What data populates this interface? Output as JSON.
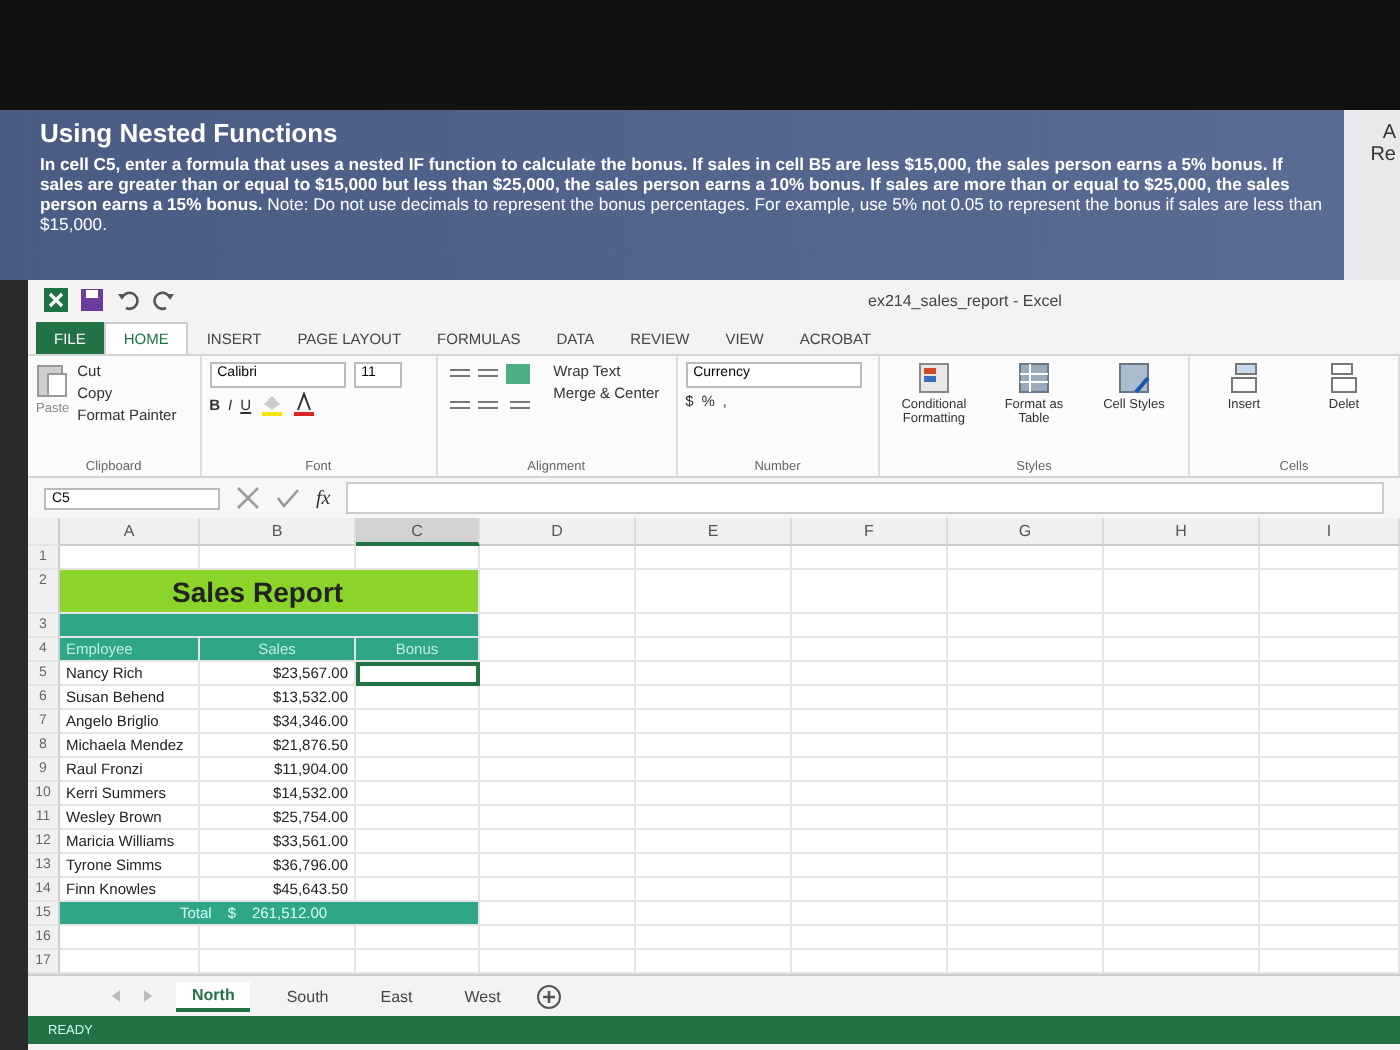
{
  "instructions": {
    "title": "Using Nested Functions",
    "text": "**In cell C5, enter a formula that uses a nested IF function to calculate the bonus. If sales in cell B5 are less $15,000, the sales person earns a 5% bonus. If sales are greater than or equal to $15,000 but less than $25,000, the sales person earns a 10% bonus. If sales are more than or equal to $25,000, the sales person earns a 15% bonus.** Note: Do not use decimals to represent the bonus percentages. For example, use 5% not 0.05 to represent the bonus if sales are less than $15,000."
  },
  "side_panel": [
    "A",
    "Re"
  ],
  "window": {
    "title": "ex214_sales_report - Excel"
  },
  "tabs": [
    {
      "label": "FILE",
      "kind": "file",
      "selected": false
    },
    {
      "label": "HOME",
      "kind": "tab",
      "selected": true
    },
    {
      "label": "INSERT",
      "kind": "tab",
      "selected": false
    },
    {
      "label": "PAGE LAYOUT",
      "kind": "tab",
      "selected": false
    },
    {
      "label": "FORMULAS",
      "kind": "tab",
      "selected": false
    },
    {
      "label": "DATA",
      "kind": "tab",
      "selected": false
    },
    {
      "label": "REVIEW",
      "kind": "tab",
      "selected": false
    },
    {
      "label": "VIEW",
      "kind": "tab",
      "selected": false
    },
    {
      "label": "ACROBAT",
      "kind": "tab",
      "selected": false
    }
  ],
  "ribbon": {
    "clipboard": {
      "paste": "Paste",
      "cut": "Cut",
      "copy": "Copy",
      "format_painter": "Format Painter",
      "label": "Clipboard"
    },
    "font": {
      "name": "Calibri",
      "size": "11",
      "bold": "B",
      "italic": "I",
      "underline": "U",
      "label": "Font"
    },
    "alignment": {
      "wrap": "Wrap Text",
      "merge": "Merge & Center",
      "label": "Alignment"
    },
    "number": {
      "format": "Currency",
      "dollar": "$",
      "percent": "%",
      "comma": ",",
      "label": "Number"
    },
    "styles": {
      "conditional": "Conditional Formatting",
      "table": "Format as Table",
      "cell": "Cell Styles",
      "label": "Styles"
    },
    "cells": {
      "insert": "Insert",
      "delete": "Delet",
      "label": "Cells"
    }
  },
  "formula_bar": {
    "name_box": "C5",
    "fx": "fx"
  },
  "columns": [
    {
      "label": "A",
      "selected": false
    },
    {
      "label": "B",
      "selected": false
    },
    {
      "label": "C",
      "selected": true
    },
    {
      "label": "D",
      "selected": false
    },
    {
      "label": "E",
      "selected": false
    },
    {
      "label": "F",
      "selected": false
    },
    {
      "label": "G",
      "selected": false
    },
    {
      "label": "H",
      "selected": false
    },
    {
      "label": "I",
      "selected": false
    }
  ],
  "rows": [
    {
      "number": "1",
      "kind": "blank"
    },
    {
      "number": "2",
      "kind": "title",
      "text": "Sales Report"
    },
    {
      "number": "3",
      "kind": "band"
    },
    {
      "number": "4",
      "kind": "header",
      "cells": [
        "Employee",
        "Sales",
        "Bonus"
      ]
    },
    {
      "number": "5",
      "kind": "data",
      "employee": "Nancy Rich",
      "sales": "$23,567.00",
      "selected": true
    },
    {
      "number": "6",
      "kind": "data",
      "employee": "Susan Behend",
      "sales": "$13,532.00",
      "selected": false
    },
    {
      "number": "7",
      "kind": "data",
      "employee": "Angelo Briglio",
      "sales": "$34,346.00",
      "selected": false
    },
    {
      "number": "8",
      "kind": "data",
      "employee": "Michaela Mendez",
      "sales": "$21,876.50",
      "selected": false
    },
    {
      "number": "9",
      "kind": "data",
      "employee": "Raul Fronzi",
      "sales": "$11,904.00",
      "selected": false
    },
    {
      "number": "10",
      "kind": "data",
      "employee": "Kerri Summers",
      "sales": "$14,532.00",
      "selected": false
    },
    {
      "number": "11",
      "kind": "data",
      "employee": "Wesley Brown",
      "sales": "$25,754.00",
      "selected": false
    },
    {
      "number": "12",
      "kind": "data",
      "employee": "Maricia Williams",
      "sales": "$33,561.00",
      "selected": false
    },
    {
      "number": "13",
      "kind": "data",
      "employee": "Tyrone Simms",
      "sales": "$36,796.00",
      "selected": false
    },
    {
      "number": "14",
      "kind": "data",
      "employee": "Finn Knowles",
      "sales": "$45,643.50",
      "selected": false
    },
    {
      "number": "15",
      "kind": "total",
      "label": "Total",
      "currency": "$",
      "amount": "261,512.00"
    },
    {
      "number": "16",
      "kind": "blank"
    },
    {
      "number": "17",
      "kind": "blank"
    }
  ],
  "sheets": [
    {
      "label": "North",
      "selected": true
    },
    {
      "label": "South",
      "selected": false
    },
    {
      "label": "East",
      "selected": false
    },
    {
      "label": "West",
      "selected": false
    }
  ],
  "status_bar": "READY"
}
